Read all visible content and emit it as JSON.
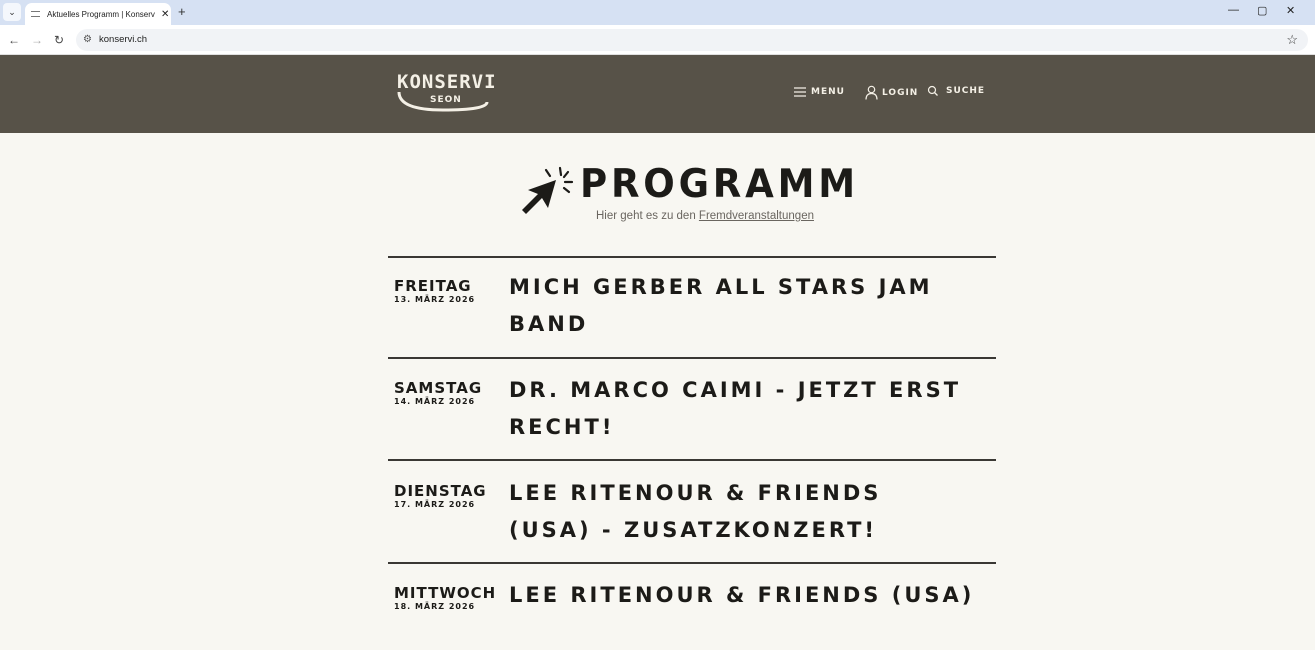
{
  "browser": {
    "tab_title": "Aktuelles Programm | Konservi",
    "tab_close": "✕",
    "new_tab": "+",
    "url": "konservi.ch",
    "window_controls": [
      "—",
      "▢",
      "✕"
    ]
  },
  "header": {
    "logo_main": "KONSERVI",
    "logo_sub": "SEON",
    "menu_label": "Menu",
    "login_label": "Login",
    "search_label": "Suche",
    "bg_color": "#575248"
  },
  "page": {
    "title": "PROGRAMM",
    "subline_prefix": "Hier geht es zu den ",
    "subline_link": "Fremdveranstaltungen"
  },
  "events": [
    {
      "day": "Freitag",
      "date": "13. März 2026",
      "title": "Mich Gerber All Stars Jam Band"
    },
    {
      "day": "Samstag",
      "date": "14. März 2026",
      "title": "Dr. Marco Caimi - Jetzt erst recht!"
    },
    {
      "day": "Dienstag",
      "date": "17. März 2026",
      "title": "Lee Ritenour & Friends (USA) - Zusatzkonzert!"
    },
    {
      "day": "Mittwoch",
      "date": "18. März 2026",
      "title": "Lee Ritenour & Friends (USA)"
    }
  ]
}
